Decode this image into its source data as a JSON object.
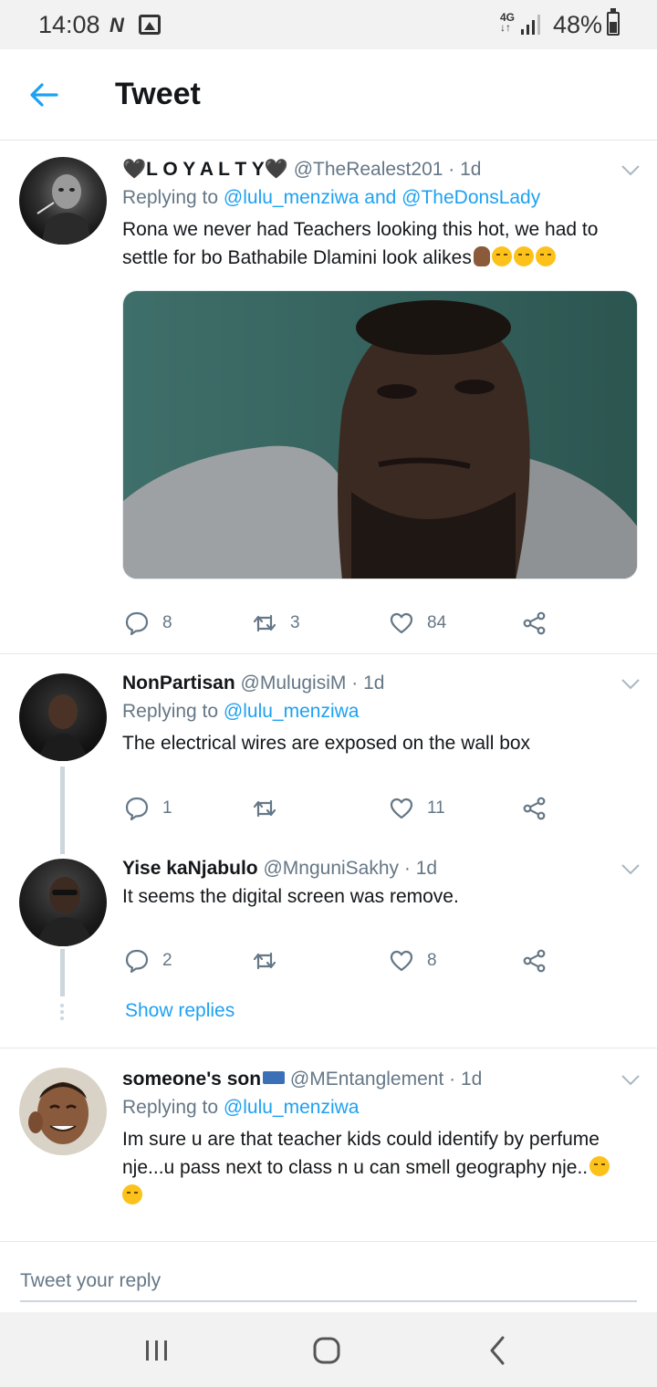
{
  "status_bar": {
    "time": "14:08",
    "network": "4G",
    "battery": "48%"
  },
  "header": {
    "title": "Tweet"
  },
  "tweets": [
    {
      "name": "🖤L O Y A L T Y🖤",
      "handle": "@TheRealest201",
      "time": "1d",
      "replying_prefix": "Replying to",
      "replying_to": "@lulu_menziwa and @TheDonsLady",
      "text": "Rona we never had Teachers looking this hot, we had to settle for bo Bathabile Dlamini look alikes",
      "replies": "8",
      "retweets": "3",
      "likes": "84"
    },
    {
      "name": "NonPartisan",
      "handle": "@MulugisiM",
      "time": "1d",
      "replying_prefix": "Replying to",
      "replying_to": "@lulu_menziwa",
      "text": "The electrical wires are exposed on the wall box",
      "replies": "1",
      "retweets": "",
      "likes": "11"
    },
    {
      "name": "Yise kaNjabulo",
      "handle": "@MnguniSakhy",
      "time": "1d",
      "text": "It seems the digital screen was remove.",
      "replies": "2",
      "retweets": "",
      "likes": "8"
    },
    {
      "name": "someone's son",
      "handle": "@MEntanglement",
      "time": "1d",
      "replying_prefix": "Replying to",
      "replying_to": "@lulu_menziwa",
      "text": "Im sure u are that teacher kids could identify by perfume nje...u pass next to class n u can smell geography nje.."
    }
  ],
  "show_replies": "Show replies",
  "reply_bar": {
    "placeholder": "Tweet your reply"
  },
  "icons": {
    "back": "arrow-left-icon",
    "reply": "comment-icon",
    "retweet": "retweet-icon",
    "like": "heart-icon",
    "share": "share-icon",
    "more": "chevron-down-icon"
  },
  "colors": {
    "accent": "#1da1f2",
    "secondary_text": "#657786",
    "divider": "#e1e8ed"
  }
}
